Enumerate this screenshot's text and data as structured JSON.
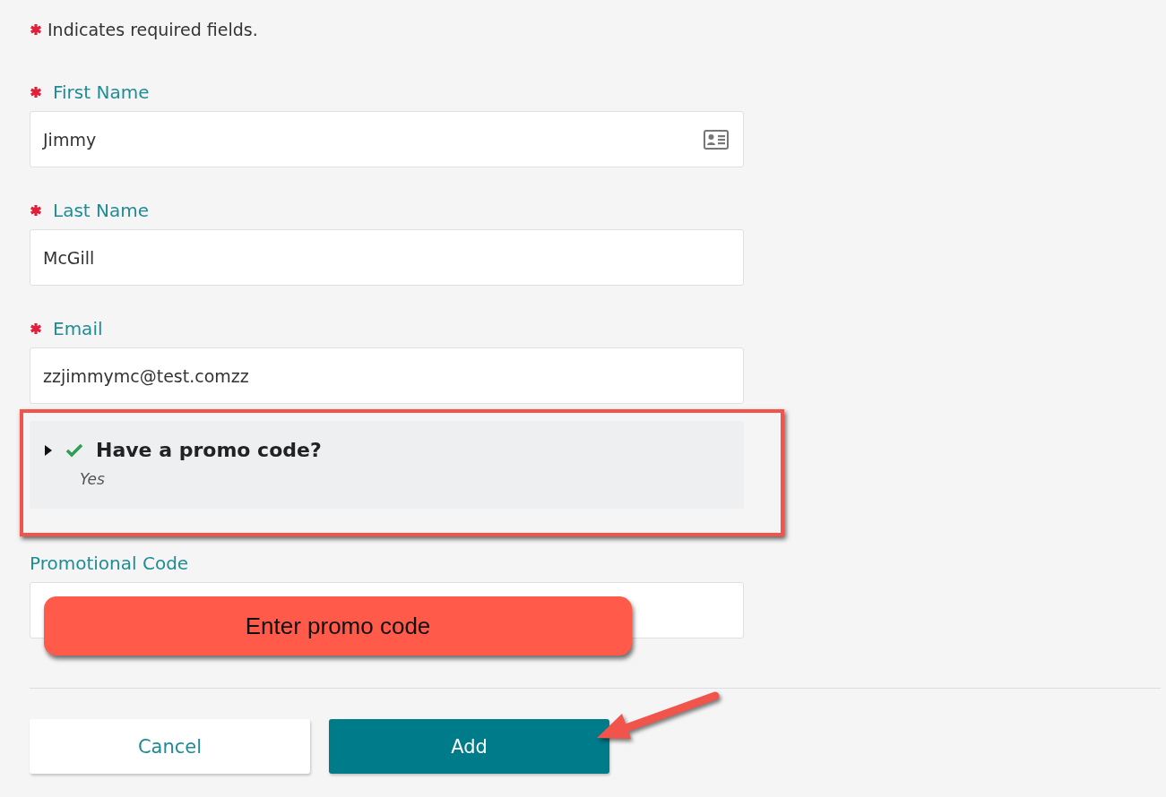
{
  "required_note": {
    "text": "Indicates required fields."
  },
  "fields": [
    {
      "label": "First Name",
      "required": true,
      "value": "Jimmy",
      "kind": "contact-card"
    },
    {
      "label": "Last Name",
      "required": true,
      "value": "McGill",
      "kind": "text"
    },
    {
      "label": "Email",
      "required": true,
      "value": "zzjimmymc@test.comzz",
      "kind": "text"
    }
  ],
  "promo_section": {
    "title": "Have a promo code?",
    "answer": "Yes",
    "expanded": false,
    "answered": true
  },
  "promo_field": {
    "label": "Promotional Code"
  },
  "callout": {
    "text": "Enter promo code"
  },
  "buttons": [
    {
      "label": "Cancel",
      "kind": "secondary"
    },
    {
      "label": "Add",
      "kind": "primary"
    }
  ]
}
